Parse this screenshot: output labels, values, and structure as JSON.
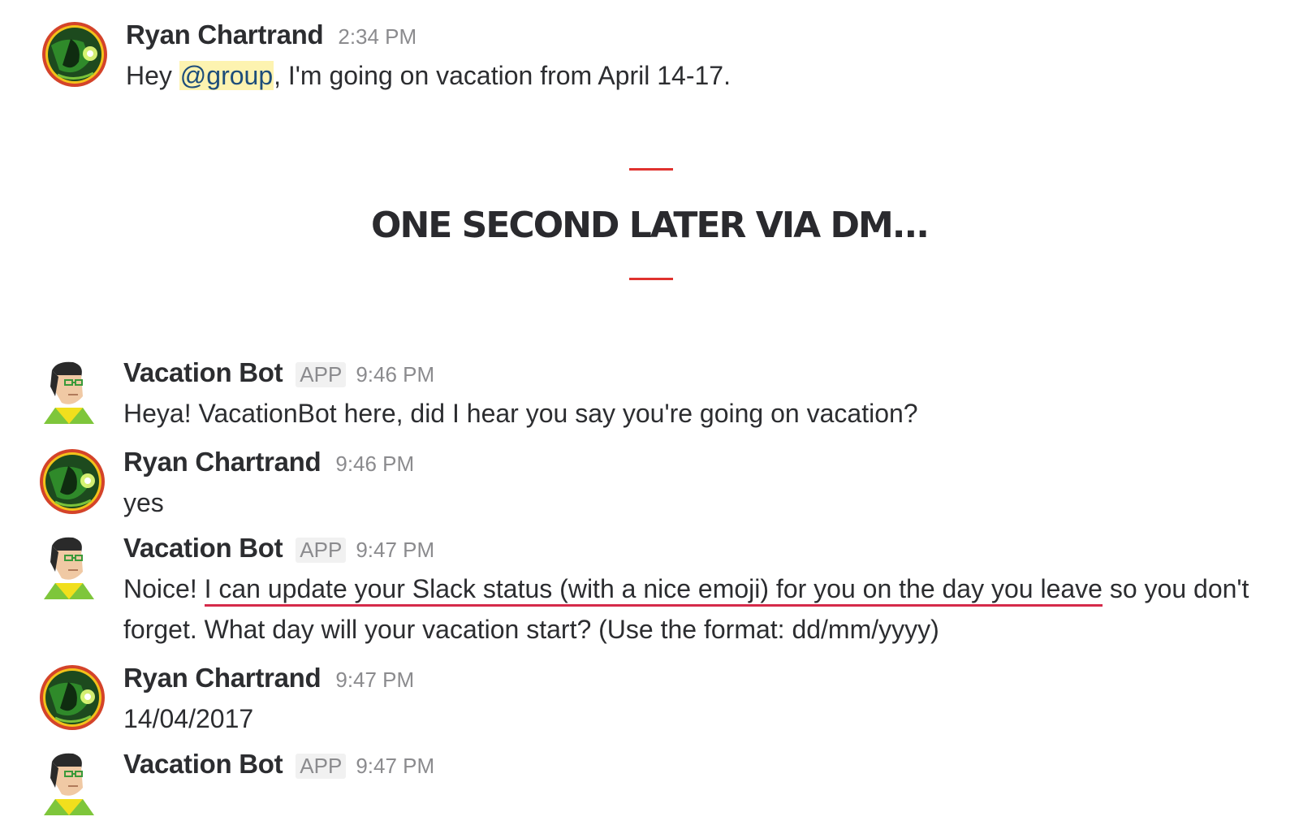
{
  "messages": [
    {
      "id": "m1",
      "sender": "Ryan Chartrand",
      "time": "2:34 PM",
      "text_pre": "Hey ",
      "mention": "@group",
      "text_post": ", I'm going on vacation from April 14-17."
    },
    {
      "id": "m2",
      "sender": "Vacation Bot",
      "badge": "APP",
      "time": "9:46 PM",
      "text": "Heya! VacationBot here, did I hear you say you're going on vacation?"
    },
    {
      "id": "m3",
      "sender": "Ryan Chartrand",
      "time": "9:46 PM",
      "text": "yes"
    },
    {
      "id": "m4",
      "sender": "Vacation Bot",
      "badge": "APP",
      "time": "9:47 PM",
      "text_pre": "Noice! ",
      "text_underlined": "I can update your Slack status (with a nice emoji) for you on the day you leave",
      "text_post": " so you don't forget. What day will your vacation start? (Use the format: dd/mm/yyyy)"
    },
    {
      "id": "m5",
      "sender": "Ryan Chartrand",
      "time": "9:47 PM",
      "text": "14/04/2017"
    },
    {
      "id": "m6",
      "sender": "Vacation Bot",
      "badge": "APP",
      "time": "9:47 PM"
    }
  ],
  "banner": {
    "text": "ONE SECOND LATER VIA DM..."
  },
  "colors": {
    "divider": "#e0322e",
    "underline": "#d52a4a",
    "mention_bg": "#fdf3b0",
    "avatar_ring": "#d4432a"
  },
  "icons": {
    "ryan_avatar": "hero-avatar-icon",
    "bot_avatar": "bot-avatar-icon"
  }
}
